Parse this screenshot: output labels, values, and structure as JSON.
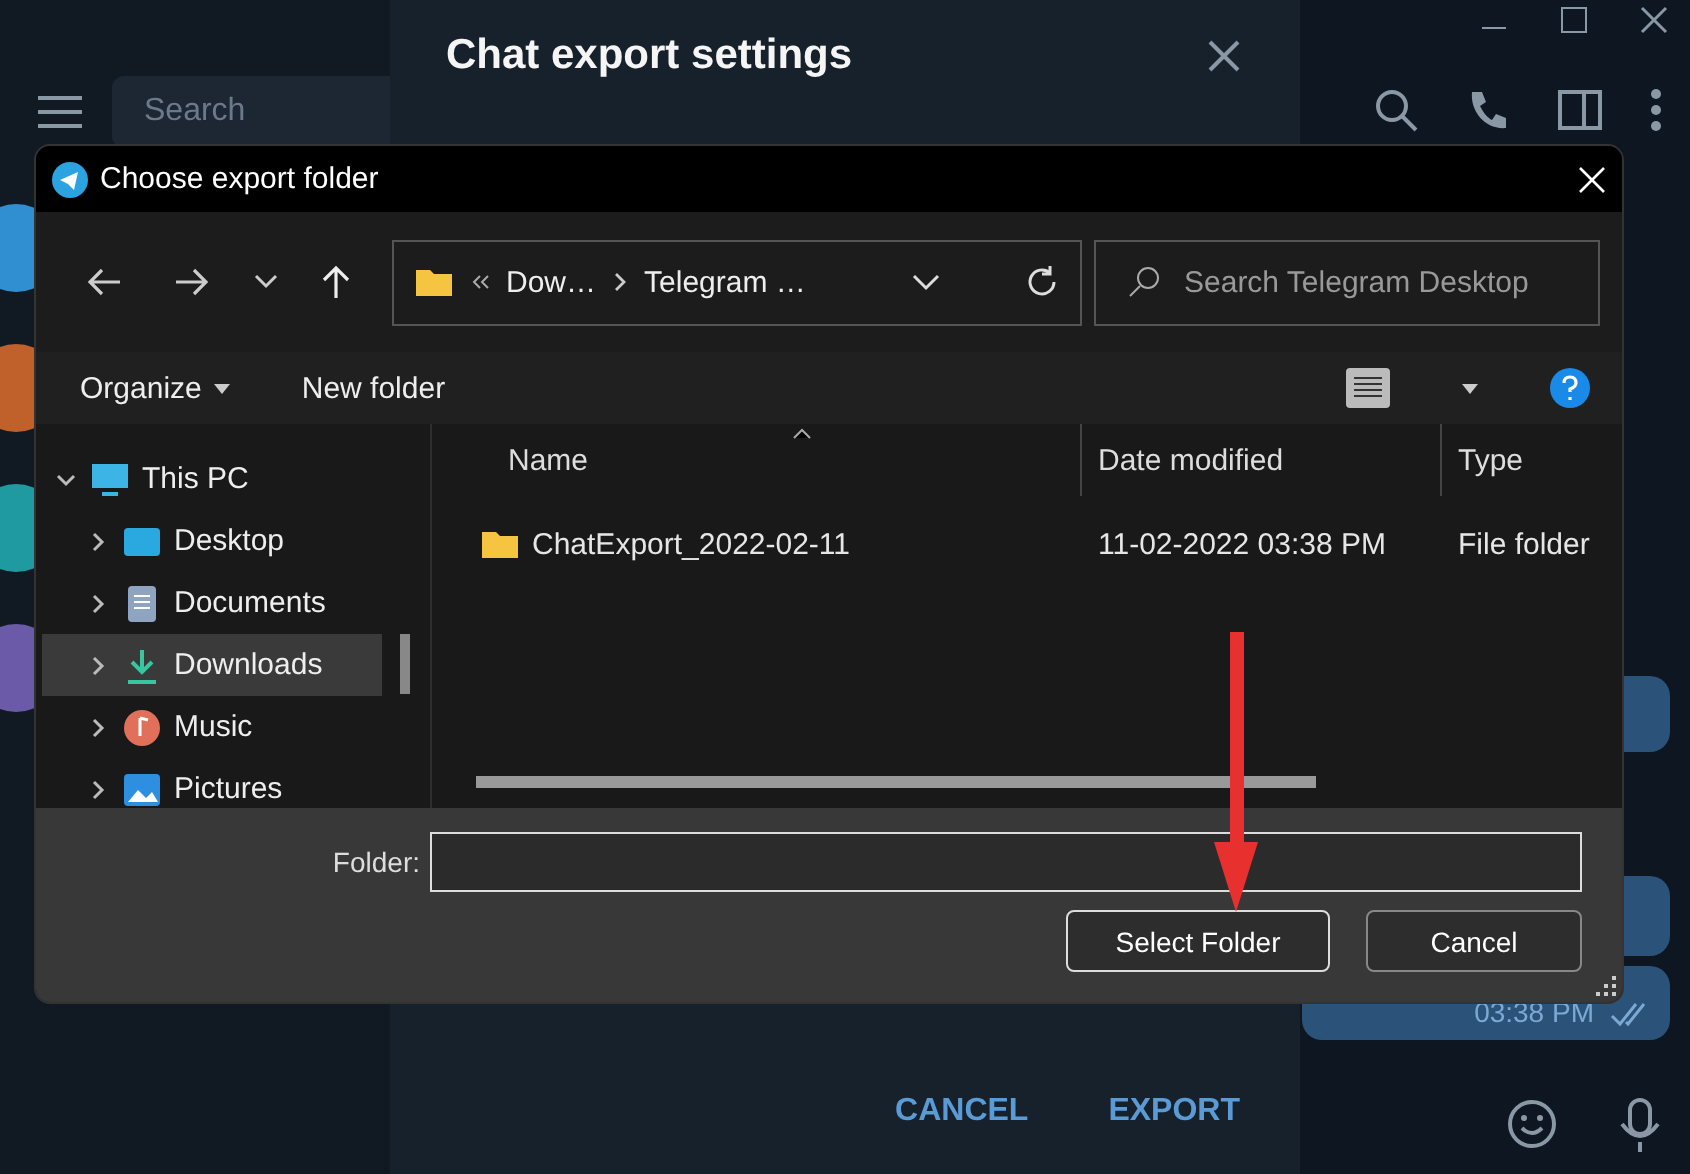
{
  "app": {
    "search_placeholder": "Search"
  },
  "export_dialog": {
    "title": "Chat export settings",
    "buttons": [
      "CANCEL",
      "EXPORT"
    ]
  },
  "chat": {
    "message_time": "03:38 PM"
  },
  "file_dialog": {
    "title": "Choose export folder",
    "breadcrumb": [
      "Dow…",
      "Telegram …"
    ],
    "search_placeholder": "Search Telegram Desktop",
    "toolbar": [
      {
        "label": "Organize",
        "kind": "menu"
      },
      {
        "label": "New folder",
        "kind": "plain"
      }
    ],
    "tree": [
      {
        "label": "This PC",
        "kind": "pc",
        "expanded": true,
        "selected": false,
        "children": [
          {
            "label": "Desktop",
            "kind": "desktop",
            "expanded": false,
            "selected": false
          },
          {
            "label": "Documents",
            "kind": "documents",
            "expanded": false,
            "selected": false
          },
          {
            "label": "Downloads",
            "kind": "downloads",
            "expanded": false,
            "selected": true
          },
          {
            "label": "Music",
            "kind": "music",
            "expanded": false,
            "selected": false
          },
          {
            "label": "Pictures",
            "kind": "pictures",
            "expanded": false,
            "selected": false
          }
        ]
      }
    ],
    "columns": [
      "Name",
      "Date modified",
      "Type"
    ],
    "rows": [
      {
        "name": "ChatExport_2022-02-11",
        "date": "11-02-2022 03:38 PM",
        "type": "File folder"
      }
    ],
    "folder_label": "Folder:",
    "buttons": [
      {
        "label": "Select Folder",
        "kind": "primary"
      },
      {
        "label": "Cancel",
        "kind": "secondary"
      }
    ]
  }
}
